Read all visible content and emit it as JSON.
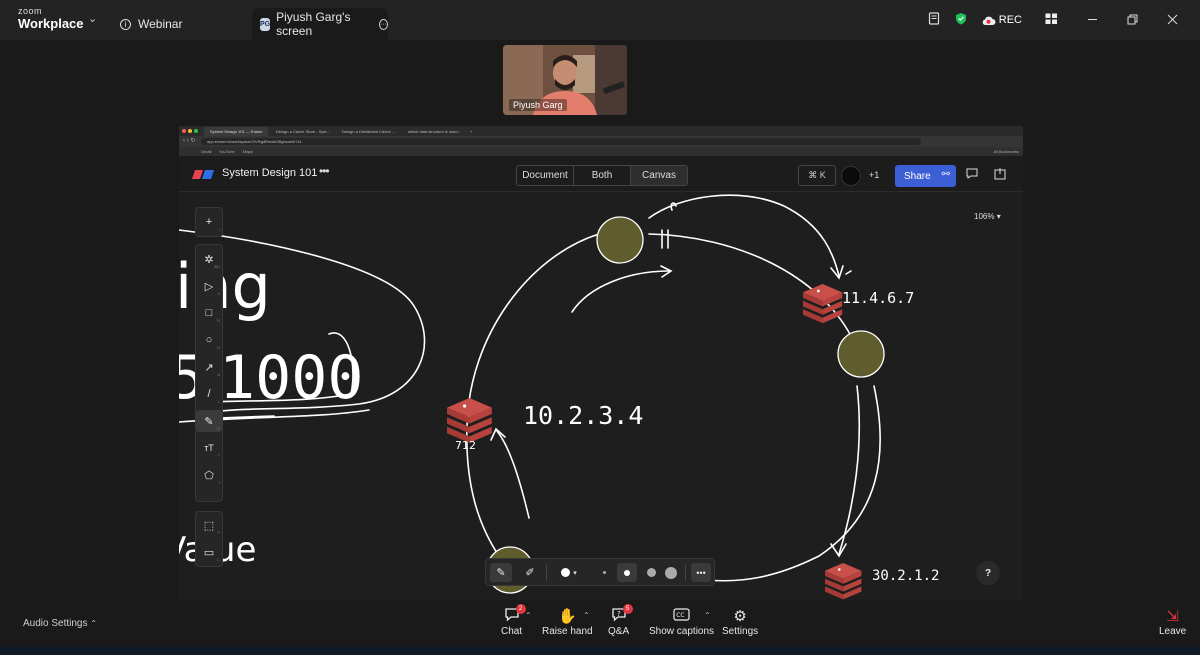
{
  "zoom": {
    "brand_small": "zoom",
    "brand_name": "Workplace",
    "tabs": [
      {
        "label": "Webinar"
      },
      {
        "label": "Piyush Garg's screen",
        "badge": "PG"
      }
    ],
    "rec_label": "REC"
  },
  "participant": {
    "name": "Piyush Garg"
  },
  "browser": {
    "tabs": [
      "System Design 101 — Eraser",
      "Design a Cache Store - Syst...",
      "Design a Distributed Cache ...",
      "which data structure is used..."
    ],
    "url": "app.eraser.io/workspace/2rVRgdRmwh2Bghsoehl?s1",
    "bookmarks": [
      "Gmail",
      "YouTube",
      "Maps"
    ],
    "bookmarks_right": "All Bookmarks"
  },
  "eraser": {
    "doc_title": "System Design 101",
    "view_modes": [
      "Document",
      "Both",
      "Canvas"
    ],
    "active_view": "Canvas",
    "cmdk": "⌘ K",
    "collab_count": "+1",
    "share_label": "Share",
    "zoom_level": "106%",
    "help": "?",
    "tools": [
      {
        "name": "add",
        "glyph": "+",
        "key": "/"
      },
      {
        "name": "ai",
        "glyph": "✲",
        "key": "⌘J"
      },
      {
        "name": "select",
        "glyph": "▷",
        "key": "V"
      },
      {
        "name": "rectangle",
        "glyph": "□",
        "key": "R"
      },
      {
        "name": "ellipse",
        "glyph": "○",
        "key": "O"
      },
      {
        "name": "arrow",
        "glyph": "↗",
        "key": "A"
      },
      {
        "name": "line",
        "glyph": "/",
        "key": "L"
      },
      {
        "name": "pen",
        "glyph": "✎",
        "key": "P"
      },
      {
        "name": "text",
        "glyph": "ᴛT",
        "key": "T"
      },
      {
        "name": "shapes",
        "glyph": "⬠",
        "key": "I"
      },
      {
        "name": "frame",
        "glyph": "⬚",
        "key": "F"
      },
      {
        "name": "comment",
        "glyph": "▭",
        "key": "C"
      }
    ]
  },
  "canvas": {
    "left_texts": [
      "ing",
      "1000",
      "Value"
    ],
    "node_labels": [
      "10.2.3.4",
      "11.4.6.7",
      "30.2.1.2"
    ],
    "small_label": "712",
    "colors": {
      "node_fill": "#5f5c2d",
      "redis": "#c9504a",
      "ink": "#ffffff"
    }
  },
  "bottom": {
    "audio_settings": "Audio Settings",
    "buttons": [
      {
        "label": "Chat",
        "badge": "2"
      },
      {
        "label": "Raise hand"
      },
      {
        "label": "Q&A",
        "badge": "5"
      },
      {
        "label": "Show captions"
      },
      {
        "label": "Settings"
      }
    ],
    "leave": "Leave"
  }
}
